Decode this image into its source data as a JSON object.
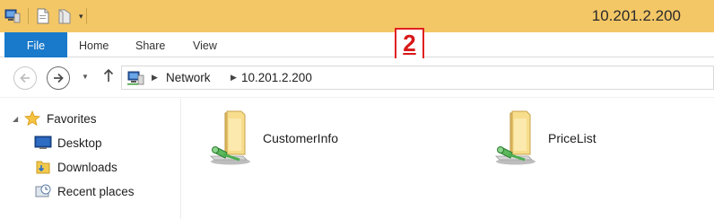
{
  "titlebar": {
    "title": "10.201.2.200",
    "quick_access": [
      "computer-icon",
      "properties-icon",
      "new-folder-icon",
      "customize-dropdown-icon"
    ]
  },
  "ribbon": {
    "tabs": [
      {
        "label": "File",
        "active": true
      },
      {
        "label": "Home"
      },
      {
        "label": "Share"
      },
      {
        "label": "View"
      }
    ]
  },
  "marker": {
    "number": "2"
  },
  "address": {
    "segments": [
      "Network",
      "10.201.2.200"
    ]
  },
  "navpane": {
    "items": [
      {
        "label": "Favorites",
        "icon": "star-icon"
      },
      {
        "label": "Desktop",
        "icon": "desktop-icon"
      },
      {
        "label": "Downloads",
        "icon": "downloads-icon"
      },
      {
        "label": "Recent places",
        "icon": "recent-places-icon"
      }
    ]
  },
  "content": {
    "items": [
      {
        "label": "CustomerInfo",
        "icon": "network-share-folder-icon"
      },
      {
        "label": "PriceList",
        "icon": "network-share-folder-icon"
      }
    ]
  },
  "colors": {
    "titlebar": "#f4c766",
    "file_tab": "#1979ca",
    "marker": "#e02020"
  }
}
